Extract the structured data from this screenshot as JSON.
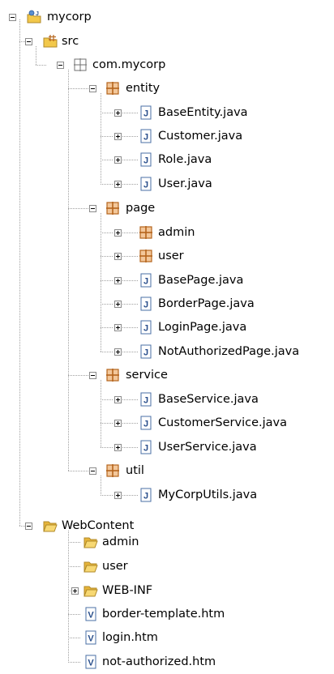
{
  "tree": {
    "project": "mycorp",
    "src": "src",
    "pkg_root": "com.mycorp",
    "entity": {
      "label": "entity",
      "files": [
        "BaseEntity.java",
        "Customer.java",
        "Role.java",
        "User.java"
      ]
    },
    "page": {
      "label": "page",
      "subpackages": [
        "admin",
        "user"
      ],
      "files": [
        "BasePage.java",
        "BorderPage.java",
        "LoginPage.java",
        "NotAuthorizedPage.java"
      ]
    },
    "service": {
      "label": "service",
      "files": [
        "BaseService.java",
        "CustomerService.java",
        "UserService.java"
      ]
    },
    "util": {
      "label": "util",
      "files": [
        "MyCorpUtils.java"
      ]
    },
    "webcontent": {
      "label": "WebContent",
      "folders": [
        "admin",
        "user",
        "WEB-INF"
      ],
      "files": [
        "border-template.htm",
        "login.htm",
        "not-authorized.htm"
      ]
    }
  },
  "colors": {
    "package": "#b5651d",
    "java_icon": "#4a6fa5",
    "folder": "#f2c84b",
    "guide": "#a0a0a0"
  }
}
